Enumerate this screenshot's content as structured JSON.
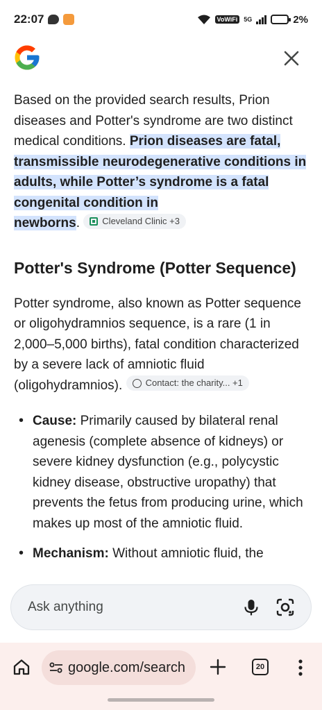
{
  "status_bar": {
    "time": "22:07",
    "network": "VoWiFi",
    "network_gen": "5G",
    "battery": "2%"
  },
  "header": {
    "logo": "google-g-logo",
    "close_icon": "close-icon"
  },
  "answer": {
    "intro_plain": "Based on the provided search results, Prion diseases and Potter's syndrome are two distinct medical conditions. ",
    "intro_highlight_1": "Prion diseases are fatal, transmissible neurodegenerative conditions in adults, while Potter’s syndrome is a fatal congenital condition in",
    "intro_highlight_2": "newborns",
    "intro_period": ".",
    "source_chip_1": "Cleveland Clinic +3",
    "section_title": "Potter's Syndrome (Potter Sequence)",
    "section_body": "Potter syndrome, also known as Potter sequence or oligohydramnios sequence, is a rare (1 in 2,000–5,000 births), fatal condition characterized by a severe lack of amniotic fluid (oligohydramnios).",
    "source_chip_2": "Contact: the charity... +1",
    "bullets": [
      {
        "label": "Cause:",
        "text": " Primarily caused by bilateral renal agenesis (complete absence of kidneys) or severe kidney dysfunction (e.g., polycystic kidney disease, obstructive uropathy) that prevents the fetus from producing urine, which makes up most of the amniotic fluid."
      },
      {
        "label": "Mechanism:",
        "text": " Without amniotic fluid, the"
      }
    ]
  },
  "ask": {
    "placeholder": "Ask anything"
  },
  "browser": {
    "url": "google.com/search",
    "tab_count": "20"
  }
}
